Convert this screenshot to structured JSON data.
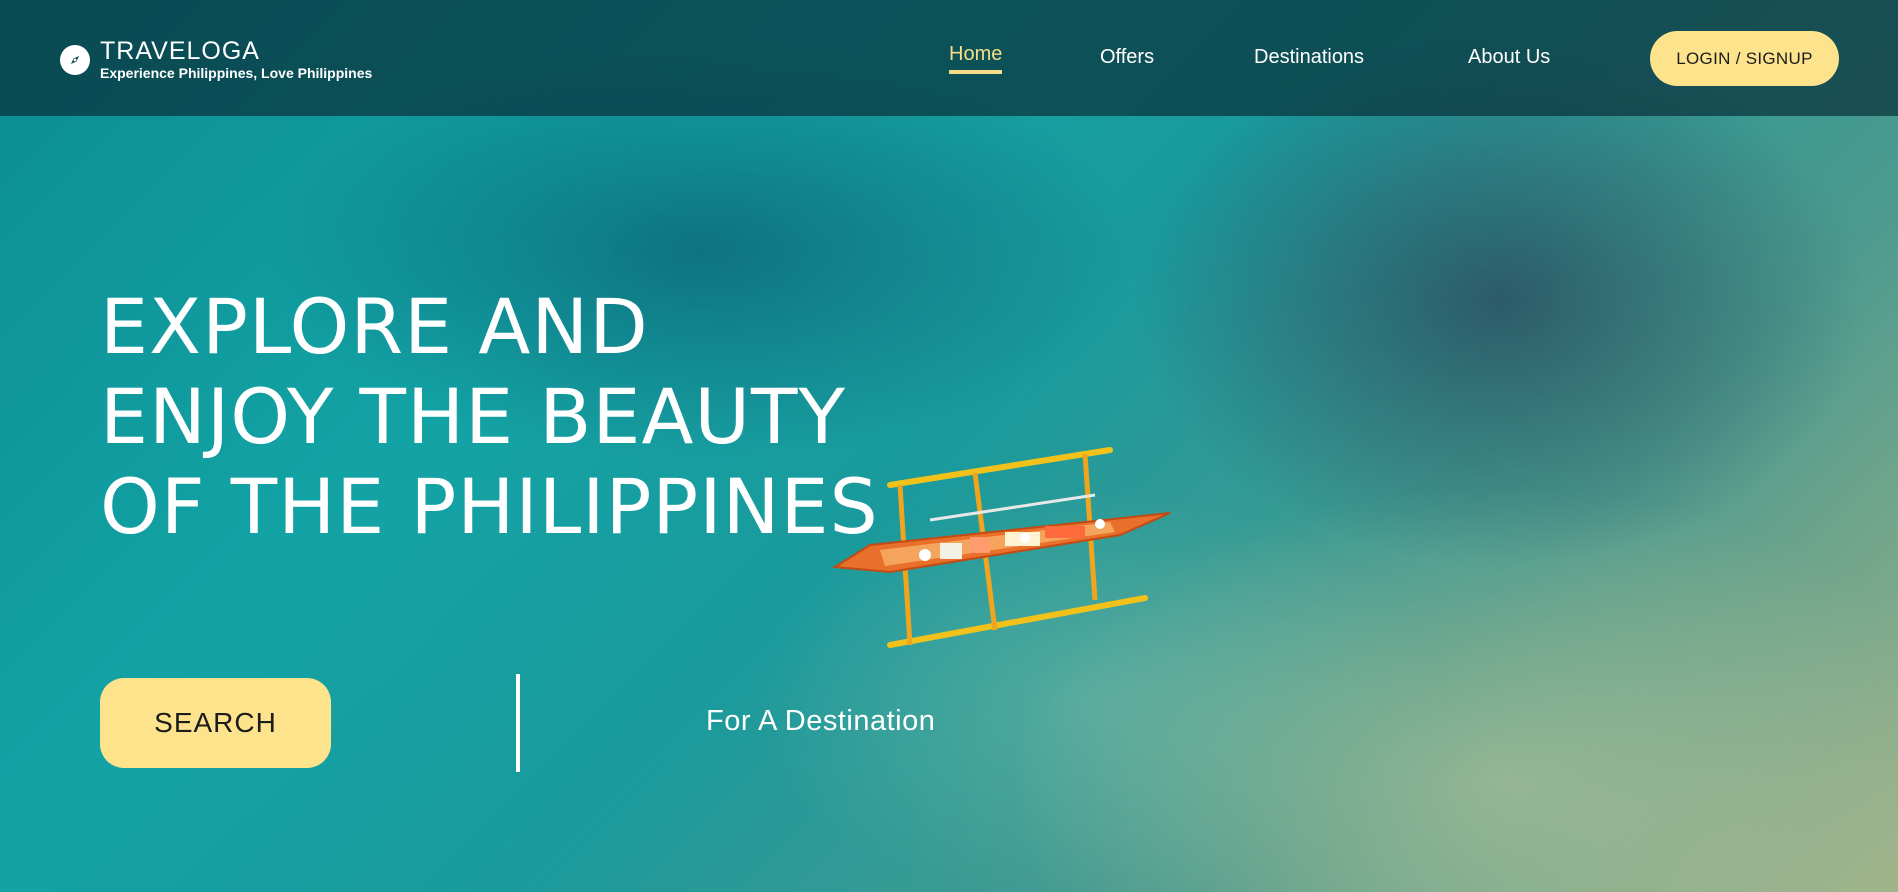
{
  "brand": {
    "title": "TRAVELOGA",
    "tagline": "Experience Philippines, Love Philippines",
    "icon": "compass-icon"
  },
  "nav": {
    "items": [
      {
        "label": "Home",
        "active": true
      },
      {
        "label": "Offers",
        "active": false
      },
      {
        "label": "Destinations",
        "active": false
      },
      {
        "label": "About Us",
        "active": false
      }
    ],
    "login_label": "LOGIN / SIGNUP"
  },
  "hero": {
    "headline_lines": [
      "EXPLORE AND",
      "ENJOY THE BEAUTY",
      "OF THE PHILIPPINES"
    ],
    "search_label": "SEARCH",
    "search_hint": "For A Destination"
  },
  "colors": {
    "accent": "#fde38c",
    "active_nav": "#f6dd86",
    "topbar": "#0a323c"
  }
}
